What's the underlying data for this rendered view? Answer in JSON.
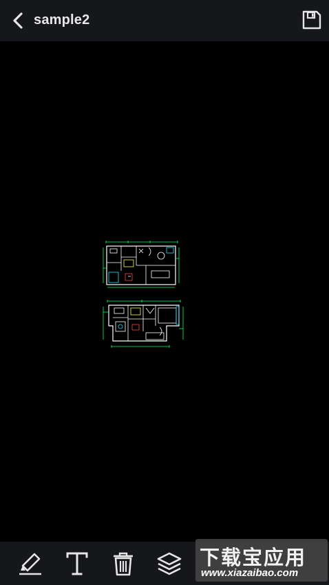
{
  "header": {
    "title": "sample2",
    "back_icon": "chevron-left-icon",
    "save_icon": "floppy-disk-icon"
  },
  "toolbar": {
    "tools": [
      "highlighter-icon",
      "text-icon",
      "trash-icon",
      "layers-icon"
    ]
  },
  "drawing": {
    "line_colors": [
      "#ffffff",
      "#00ff66",
      "#22e0ff",
      "#ffff44",
      "#ff4444"
    ]
  },
  "watermark": {
    "title": "下载宝应用",
    "url": "www.xiazaibao.com"
  },
  "colors": {
    "header_bg": "#15171b",
    "canvas_bg": "#000000",
    "icon_color": "#e6e6e6"
  }
}
